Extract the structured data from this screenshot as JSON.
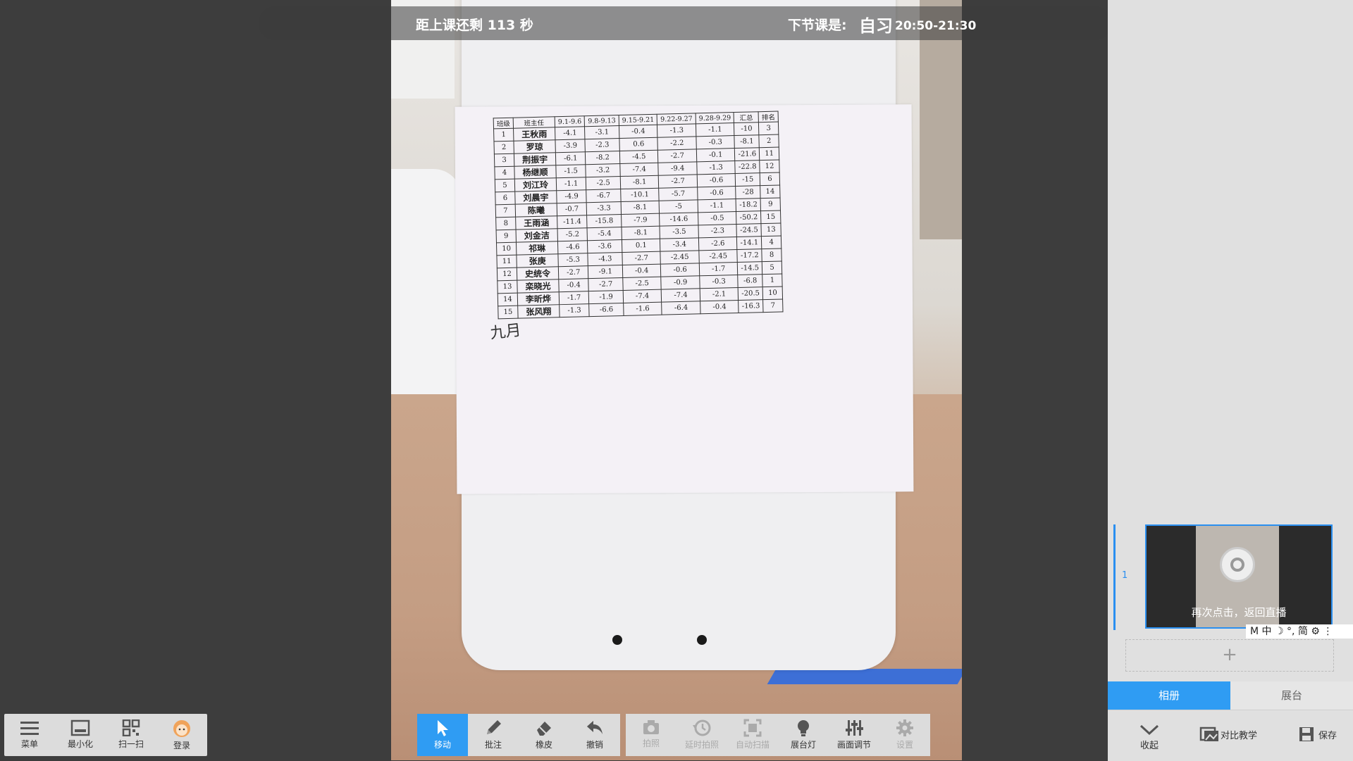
{
  "topbar": {
    "countdown": "距上课还剩 113 秒",
    "next_label": "下节课是:",
    "next_course": "自习",
    "next_time": "20:50-21:30"
  },
  "sheet": {
    "headers": [
      "班级",
      "班主任",
      "9.1-9.6",
      "9.8-9.13",
      "9.15-9.21",
      "9.22-9.27",
      "9.28-9.29",
      "汇总",
      "排名"
    ],
    "rows": [
      [
        "1",
        "王秋雨",
        "-4.1",
        "-3.1",
        "-0.4",
        "-1.3",
        "-1.1",
        "-10",
        "3"
      ],
      [
        "2",
        "罗琼",
        "-3.9",
        "-2.3",
        "0.6",
        "-2.2",
        "-0.3",
        "-8.1",
        "2"
      ],
      [
        "3",
        "荆振宇",
        "-6.1",
        "-8.2",
        "-4.5",
        "-2.7",
        "-0.1",
        "-21.6",
        "11"
      ],
      [
        "4",
        "杨继顺",
        "-1.5",
        "-3.2",
        "-7.4",
        "-9.4",
        "-1.3",
        "-22.8",
        "12"
      ],
      [
        "5",
        "刘江玲",
        "-1.1",
        "-2.5",
        "-8.1",
        "-2.7",
        "-0.6",
        "-15",
        "6"
      ],
      [
        "6",
        "刘晨宇",
        "-4.9",
        "-6.7",
        "-10.1",
        "-5.7",
        "-0.6",
        "-28",
        "14"
      ],
      [
        "7",
        "陈曦",
        "-0.7",
        "-3.3",
        "-8.1",
        "-5",
        "-1.1",
        "-18.2",
        "9"
      ],
      [
        "8",
        "王雨涵",
        "-11.4",
        "-15.8",
        "-7.9",
        "-14.6",
        "-0.5",
        "-50.2",
        "15"
      ],
      [
        "9",
        "刘金洁",
        "-5.2",
        "-5.4",
        "-8.1",
        "-3.5",
        "-2.3",
        "-24.5",
        "13"
      ],
      [
        "10",
        "祁琳",
        "-4.6",
        "-3.6",
        "0.1",
        "-3.4",
        "-2.6",
        "-14.1",
        "4"
      ],
      [
        "11",
        "张庚",
        "-5.3",
        "-4.3",
        "-2.7",
        "-2.45",
        "-2.45",
        "-17.2",
        "8"
      ],
      [
        "12",
        "史统令",
        "-2.7",
        "-9.1",
        "-0.4",
        "-0.6",
        "-1.7",
        "-14.5",
        "5"
      ],
      [
        "13",
        "栾晓光",
        "-0.4",
        "-2.7",
        "-2.5",
        "-0.9",
        "-0.3",
        "-6.8",
        "1"
      ],
      [
        "14",
        "李昕烨",
        "-1.7",
        "-1.9",
        "-7.4",
        "-7.4",
        "-2.1",
        "-20.5",
        "10"
      ],
      [
        "15",
        "张风翔",
        "-1.3",
        "-6.6",
        "-1.6",
        "-6.4",
        "-0.4",
        "-16.3",
        "7"
      ]
    ],
    "handwriting": "九月"
  },
  "left_toolbar": {
    "menu": "菜单",
    "minimize": "最小化",
    "scan": "扫一扫",
    "login": "登录"
  },
  "center_toolbar": {
    "move": "移动",
    "annotate": "批注",
    "eraser": "橡皮",
    "undo": "撤销",
    "capture": "拍照",
    "timer_capture": "延时拍照",
    "auto_scan": "自动扫描",
    "booth_light": "展台灯",
    "image_adjust": "画面调节",
    "settings": "设置"
  },
  "sidebar": {
    "thumb_index": "1",
    "back_live": "再次点击，返回直播",
    "add": "+",
    "ime": "M 中 ☽ °, 简 ⚙ ⋮",
    "tab_album": "相册",
    "tab_booth": "展台",
    "collapse": "收起",
    "compare": "对比教学",
    "save": "保存"
  },
  "colors": {
    "accent": "#2f9cf3",
    "toolbar_bg": "#dcdcdc",
    "stage_bg": "#3d3d3d"
  }
}
